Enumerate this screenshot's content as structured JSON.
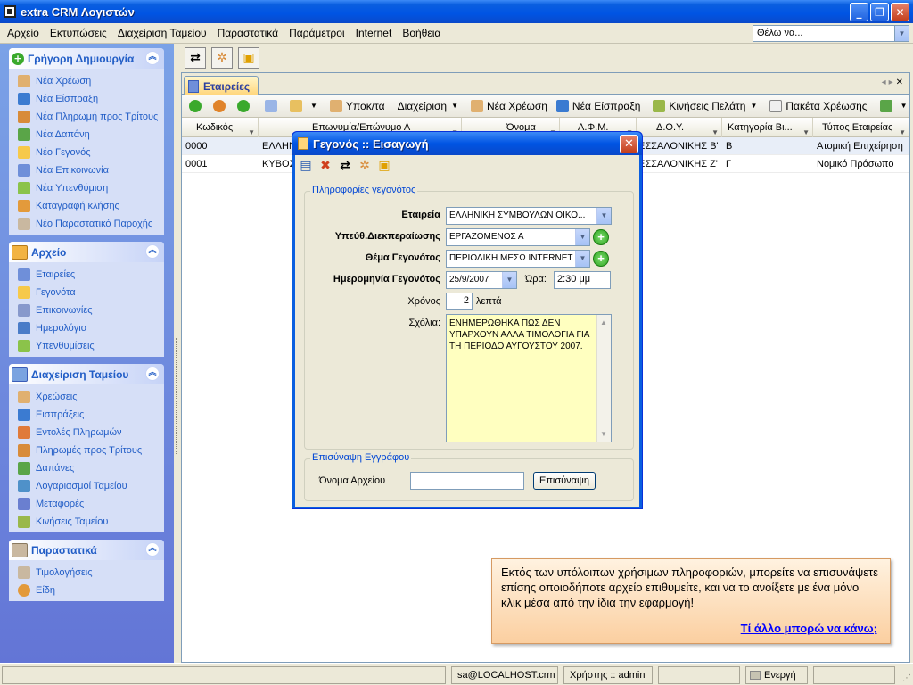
{
  "window": {
    "title": "extra CRM Λογιστών"
  },
  "menu": [
    "Αρχείο",
    "Εκτυπώσεις",
    "Διαχείριση Ταμείου",
    "Παραστατικά",
    "Παράμετροι",
    "Internet",
    "Βοήθεια"
  ],
  "want_to": {
    "value": "Θέλω να..."
  },
  "sidebar": {
    "quick_create": {
      "title": "Γρήγορη Δημιουργία",
      "items": [
        "Νέα Χρέωση",
        "Νέα Είσπραξη",
        "Νέα Πληρωμή προς Τρίτους",
        "Νέα Δαπάνη",
        "Νέο Γεγονός",
        "Νέα Επικοινωνία",
        "Νέα Υπενθύμιση",
        "Καταγραφή κλήσης",
        "Νέο Παραστατικό Παροχής"
      ]
    },
    "archive": {
      "title": "Αρχείο",
      "items": [
        "Εταιρείες",
        "Γεγονότα",
        "Επικοινωνίες",
        "Ημερολόγιο",
        "Υπενθυμίσεις"
      ]
    },
    "cash": {
      "title": "Διαχείριση Ταμείου",
      "items": [
        "Χρεώσεις",
        "Εισπράξεις",
        "Εντολές Πληρωμών",
        "Πληρωμές προς Τρίτους",
        "Δαπάνες",
        "Λογαριασμοί Ταμείου",
        "Μεταφορές",
        "Κινήσεις Ταμείου"
      ]
    },
    "docs": {
      "title": "Παραστατικά",
      "items": [
        "Τιμολογήσεις",
        "Είδη"
      ]
    }
  },
  "tab": {
    "label": "Εταιρείες"
  },
  "toolbar2": {
    "subtotal": "Υποκ/τα",
    "manage": "Διαχείριση",
    "new_charge": "Νέα Χρέωση",
    "new_receipt": "Νέα Είσπραξη",
    "client_moves": "Κινήσεις Πελάτη",
    "charge_packages": "Πακέτα Χρέωσης"
  },
  "grid": {
    "headers": [
      "Κωδικός",
      "Επωνυμία/Επώνυμο Α",
      "Όνομα",
      "Α.Φ.Μ.",
      "Δ.Ο.Υ.",
      "Κατηγορία Βι...",
      "Τύπος Εταιρείας"
    ],
    "rows": [
      [
        "0000",
        "ΕΛΛΗΝ",
        "",
        "",
        "ΕΣΣΑΛΟΝΙΚΗΣ Β'",
        "Β",
        "Ατομική Επιχείρηση"
      ],
      [
        "0001",
        "ΚΥΒΟΣ",
        "",
        "",
        "ΕΣΣΑΛΟΝΙΚΗΣ Ζ'",
        "Γ",
        "Νομικό Πρόσωπο"
      ]
    ]
  },
  "dialog": {
    "title": "Γεγονός :: Εισαγωγή",
    "info_group": "Πληροφορίες γεγονότος",
    "company_label": "Εταιρεία",
    "company_value": "ΕΛΛΗΝΙΚΗ ΣΥΜΒΟΥΛΩΝ ΟΙΚΟ...",
    "handler_label": "Υπεύθ.Διεκπεραίωσης",
    "handler_value": "ΕΡΓΑΖΟΜΕΝΟΣ Α",
    "topic_label": "Θέμα Γεγονότος",
    "topic_value": "ΠΕΡΙΟΔΙΚΗ ΜΕΣΩ INTERNET",
    "date_label": "Ημερομηνία Γεγονότος",
    "date_value": "25/9/2007",
    "time_label": "Ώρα:",
    "time_value": "2:30 μμ",
    "duration_label": "Χρόνος",
    "duration_value": "2",
    "duration_unit": "λεπτά",
    "comments_label": "Σχόλια:",
    "comments_value": "ΕΝΗΜΕΡΩΘΗΚΑ ΠΩΣ ΔΕΝ ΥΠΑΡΧΟΥΝ ΑΛΛΑ ΤΙΜΟΛΟΓΙΑ ΓΙΑ ΤΗ ΠΕΡΙΟΔΟ ΑΥΓΟΥΣΤΟΥ 2007.",
    "attach_group": "Επισύναψη Εγγράφου",
    "filename_label": "Όνομα Αρχείου",
    "filename_value": "",
    "attach_button": "Επισύναψη"
  },
  "tip": {
    "text": "Εκτός των υπόλοιπων χρήσιμων πληροφοριών, μπορείτε να επισυνάψετε επίσης οποιοδήποτε αρχείο επιθυμείτε, και να το ανοίξετε με ένα μόνο κλικ μέσα από την ίδια την εφαρμογή!",
    "link": "Τί άλλο μπορώ να κάνω;"
  },
  "status": {
    "server": "sa@LOCALHOST.crm",
    "user": "Χρήστης :: admin",
    "state": "Ενεργή"
  }
}
